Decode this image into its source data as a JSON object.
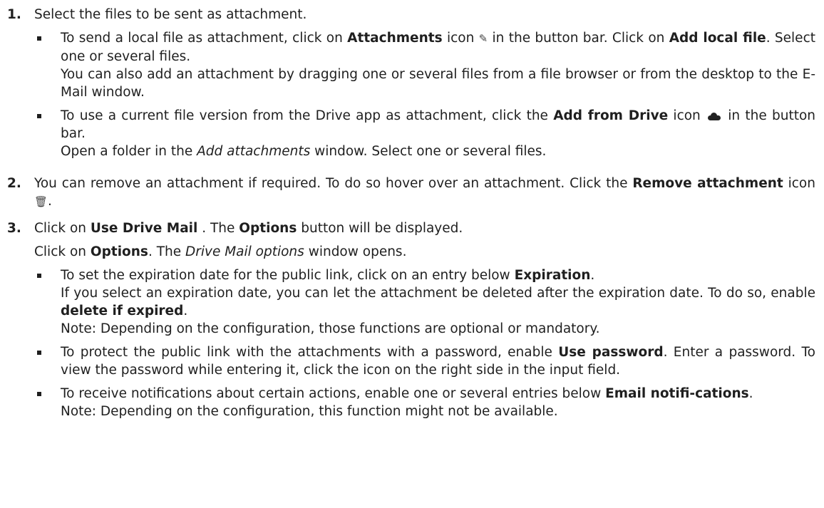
{
  "steps": [
    {
      "num": "1.",
      "title": "Select the files to be sent as attachment.",
      "bullets": [
        {
          "lines": [
            [
              "To send a local file as attachment, click on ",
              "Attachments",
              " icon ",
              "✎",
              " in the button bar. Click on ",
              "Add local file",
              ". Select one or several files."
            ],
            [
              "You can also add an attachment by dragging one or several files from a file browser or from the desktop to the E-Mail window."
            ]
          ]
        },
        {
          "lines": [
            [
              "To use a current file version from the Drive app as attachment, click the ",
              "Add from Drive",
              " icon ",
              "cloud",
              " in the button bar."
            ],
            [
              "Open a folder in the ",
              "Add attachments",
              " window. Select one or several files."
            ]
          ]
        }
      ]
    },
    {
      "num": "2.",
      "text_a": "You can remove an attachment if required. To do so hover over an attachment. Click the ",
      "bold": "Remove attachment",
      "text_b": " icon ",
      "icon": "🗑",
      "text_c": "."
    },
    {
      "num": "3.",
      "line1_a": "Click on ",
      "line1_b": "Use Drive Mail",
      "line1_c": " . The ",
      "line1_d": "Options",
      "line1_e": " button will be displayed.",
      "line2_a": "Click on ",
      "line2_b": "Options",
      "line2_c": ". The ",
      "line2_d": "Drive Mail options",
      "line2_e": " window opens.",
      "bullets": {
        "b1_a": "To set the expiration date for the public link, click on an entry below ",
        "b1_b": "Expiration",
        "b1_c": ".",
        "b1_d": "If you select an expiration date, you can let the attachment be deleted after the expiration date. To do so, enable ",
        "b1_e": "delete if expired",
        "b1_f": ".",
        "b1_g": "Note: Depending on the configuration, those functions are optional or mandatory.",
        "b2_a": "To protect the public link with the attachments with a password, enable ",
        "b2_b": "Use password",
        "b2_c": ". Enter a password. To view the password while entering it, click the icon on the right side in the input field.",
        "b3_a": "To receive notifications about certain actions, enable one or several entries below ",
        "b3_b": "Email notifi-cations",
        "b3_c": ".",
        "b3_d": "Note: Depending on the configuration, this function might not be available."
      }
    }
  ],
  "icons": {
    "attachments": "paperclip-pencil-icon",
    "drive": "cloud-icon",
    "remove": "trash-icon"
  }
}
